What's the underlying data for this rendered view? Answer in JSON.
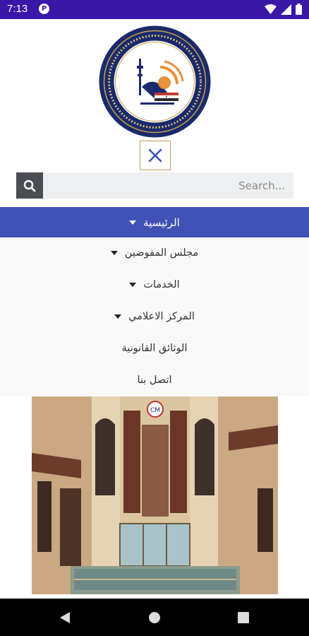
{
  "status_bar": {
    "time": "7:13",
    "app_icon": "p-icon",
    "icons": [
      "wifi-icon",
      "signal-icon",
      "battery-icon"
    ],
    "color": "#3b17a8"
  },
  "logo": {
    "name": "communications-media-commission-seal",
    "colors": {
      "ring": "#1a2a6c",
      "accent": "#e8903a"
    }
  },
  "close_button": {
    "icon": "close-icon"
  },
  "search": {
    "placeholder": "Search...",
    "value": "",
    "icon": "search-icon"
  },
  "menu": {
    "accent": "#4151b5",
    "active": {
      "label": "الرئيسية",
      "has_dropdown": true
    },
    "items": [
      {
        "label": "مجلس المفوضين",
        "has_dropdown": true
      },
      {
        "label": "الخدمات",
        "has_dropdown": true
      },
      {
        "label": "المركز الاعلامي",
        "has_dropdown": true
      },
      {
        "label": "الوثائق القانونية",
        "has_dropdown": false
      },
      {
        "label": "اتصل بنا",
        "has_dropdown": false
      }
    ]
  },
  "photo": {
    "subject": "headquarters-building"
  },
  "nav_bar": {
    "buttons": [
      "back-icon",
      "home-icon",
      "recents-icon"
    ]
  }
}
